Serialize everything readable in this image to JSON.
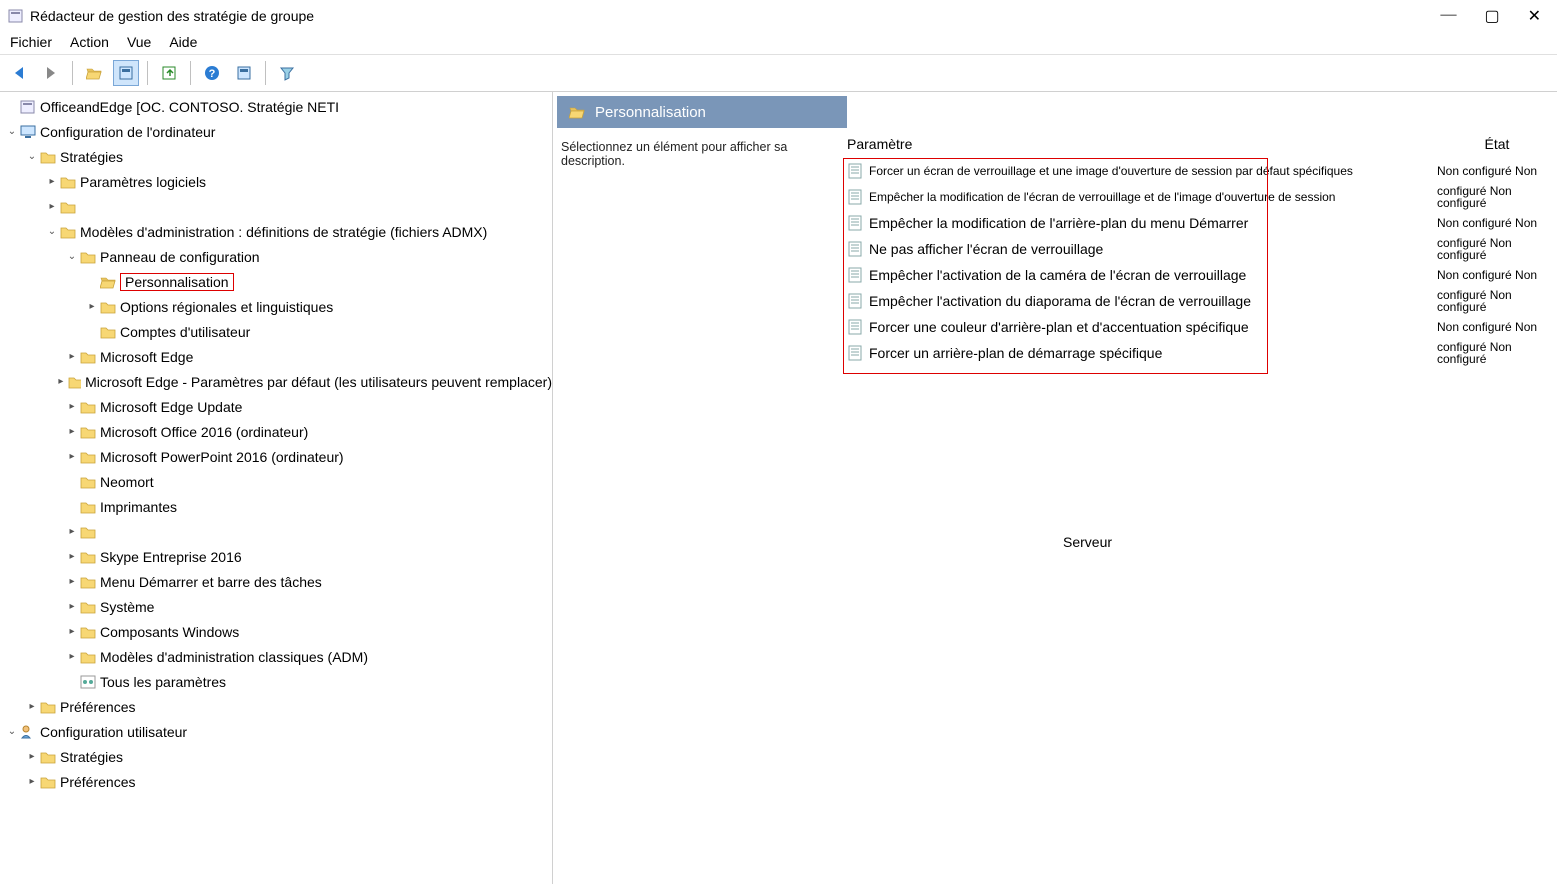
{
  "window": {
    "title": "Rédacteur de gestion des stratégie de groupe"
  },
  "menus": [
    "Fichier",
    "Action",
    "Vue",
    "Aide"
  ],
  "tree": {
    "root": "OfficeandEdge [OC. CONTOSO. Stratégie NETI",
    "computer_config": "Configuration de l'ordinateur",
    "strategies": "Stratégies",
    "software_settings": "Paramètres logiciels",
    "blank1": "",
    "admin_templates": "Modèles d'administration : définitions de stratégie (fichiers ADMX)",
    "control_panel": "Panneau de configuration",
    "personalization": "Personnalisation",
    "regional": "Options régionales et linguistiques",
    "user_accounts": "Comptes d'utilisateur",
    "edge": "Microsoft Edge",
    "edge_defaults": "Microsoft Edge - Paramètres par défaut (les utilisateurs peuvent remplacer)",
    "edge_update": "Microsoft Edge Update",
    "office2016": "Microsoft Office 2016 (ordinateur)",
    "ppt2016": "Microsoft PowerPoint 2016 (ordinateur)",
    "neomort": "Neomort",
    "printers": "Imprimantes",
    "blank2": "",
    "skype": "Skype Entreprise 2016",
    "start_taskbar": "Menu Démarrer et barre des tâches",
    "system": "Système",
    "win_components": "Composants Windows",
    "classic_adm": "Modèles d'administration classiques (ADM)",
    "all_settings": "Tous les paramètres",
    "preferences": "Préférences",
    "user_config": "Configuration utilisateur",
    "u_strategies": "Stratégies",
    "u_preferences": "Préférences"
  },
  "detail": {
    "header": "Personnalisation",
    "desc": "Sélectionnez un élément pour afficher sa description.",
    "col_param": "Paramètre",
    "col_state": "État",
    "server": "Serveur",
    "settings": [
      {
        "name": "Forcer un écran de verrouillage et une image d'ouverture de session par défaut spécifiques",
        "small": true,
        "state": "Non configuré Non"
      },
      {
        "name": "Empêcher la modification de l'écran de verrouillage et de l'image d'ouverture de session",
        "small": true,
        "state": "configuré Non configuré"
      },
      {
        "name": "Empêcher la modification de l'arrière-plan du menu Démarrer",
        "small": false,
        "state": "Non configuré Non"
      },
      {
        "name": "Ne pas afficher l'écran de verrouillage",
        "small": false,
        "state": "configuré Non configuré"
      },
      {
        "name": "Empêcher l'activation de la caméra de l'écran de verrouillage",
        "small": false,
        "state": "Non configuré Non"
      },
      {
        "name": "Empêcher l'activation du diaporama de l'écran de verrouillage",
        "small": false,
        "state": "configuré Non configuré"
      },
      {
        "name": "Forcer une couleur d'arrière-plan et d'accentuation spécifique",
        "small": false,
        "state": "Non configuré Non"
      },
      {
        "name": "Forcer un arrière-plan de démarrage spécifique",
        "small": false,
        "state": "configuré Non configuré"
      }
    ]
  }
}
